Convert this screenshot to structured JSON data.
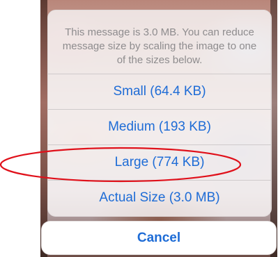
{
  "action_sheet": {
    "message": "This message is 3.0 MB. You can reduce message size by scaling the image to one of the sizes below.",
    "options": [
      {
        "label": "Small (64.4 KB)"
      },
      {
        "label": "Medium (193 KB)"
      },
      {
        "label": "Large (774 KB)"
      },
      {
        "label": "Actual Size (3.0 MB)"
      }
    ],
    "cancel_label": "Cancel"
  },
  "annotation": {
    "highlight_color": "#e0101a",
    "highlighted_option": "Large (774 KB)"
  },
  "colors": {
    "action_blue": "#1e6cd6",
    "message_gray": "#8e8c8e"
  }
}
